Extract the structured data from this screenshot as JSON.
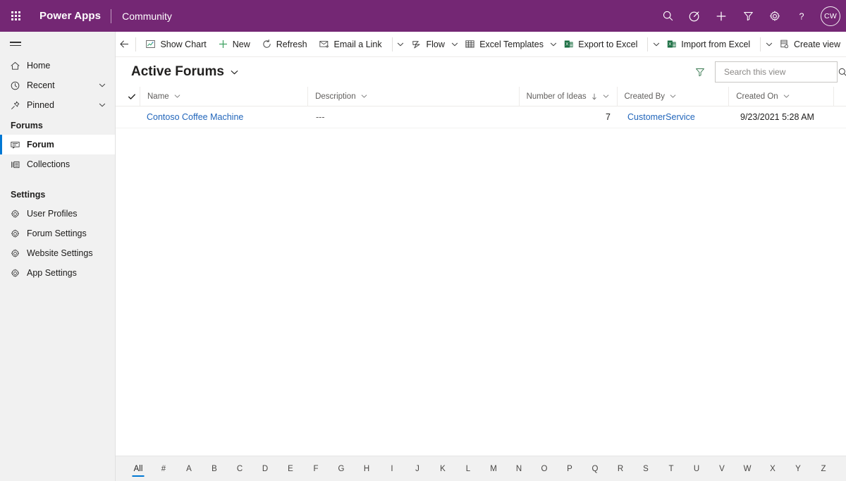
{
  "header": {
    "waffle_label": "app-launcher",
    "brand": "Power Apps",
    "app_name": "Community",
    "avatar_initials": "CW",
    "actions": [
      {
        "name": "search-icon",
        "label": "Search"
      },
      {
        "name": "diagnostics-icon",
        "label": "Diagnostics"
      },
      {
        "name": "add-icon",
        "label": "New"
      },
      {
        "name": "filter-icon",
        "label": "Filter"
      },
      {
        "name": "gear-icon",
        "label": "Settings"
      },
      {
        "name": "help-icon",
        "label": "Help"
      }
    ]
  },
  "sidebar": {
    "top_items": [
      {
        "label": "Home",
        "icon": "home-icon",
        "chevron": false
      },
      {
        "label": "Recent",
        "icon": "clock-icon",
        "chevron": true
      },
      {
        "label": "Pinned",
        "icon": "pin-icon",
        "chevron": true
      }
    ],
    "groups": [
      {
        "title": "Forums",
        "items": [
          {
            "label": "Forum",
            "icon": "forum-icon",
            "selected": true
          },
          {
            "label": "Collections",
            "icon": "collections-icon",
            "selected": false
          }
        ]
      },
      {
        "title": "Settings",
        "items": [
          {
            "label": "User Profiles",
            "icon": "gear-icon",
            "selected": false
          },
          {
            "label": "Forum Settings",
            "icon": "gear-icon",
            "selected": false
          },
          {
            "label": "Website Settings",
            "icon": "gear-icon",
            "selected": false
          },
          {
            "label": "App Settings",
            "icon": "gear-icon",
            "selected": false
          }
        ]
      }
    ]
  },
  "commandbar": {
    "back_label": "Back",
    "show_chart": "Show Chart",
    "new": "New",
    "refresh": "Refresh",
    "email_a_link": "Email a Link",
    "flow": "Flow",
    "excel_templates": "Excel Templates",
    "export_to_excel": "Export to Excel",
    "import_from_excel": "Import from Excel",
    "create_view": "Create view"
  },
  "view": {
    "title": "Active Forums",
    "filter_label": "Edit filters",
    "search_placeholder": "Search this view",
    "search_value": ""
  },
  "grid": {
    "columns": [
      {
        "key": "name",
        "label": "Name",
        "sorted": false
      },
      {
        "key": "description",
        "label": "Description",
        "sorted": false
      },
      {
        "key": "number_of_ideas",
        "label": "Number of Ideas",
        "sorted": true,
        "sort_dir": "desc"
      },
      {
        "key": "created_by",
        "label": "Created By",
        "sorted": false
      },
      {
        "key": "created_on",
        "label": "Created On",
        "sorted": false
      }
    ],
    "rows": [
      {
        "name": "Contoso Coffee Machine",
        "description": "---",
        "number_of_ideas": "7",
        "created_by": "CustomerService",
        "created_on": "9/23/2021 5:28 AM"
      }
    ]
  },
  "alphabar": {
    "selected": "All",
    "items": [
      "All",
      "#",
      "A",
      "B",
      "C",
      "D",
      "E",
      "F",
      "G",
      "H",
      "I",
      "J",
      "K",
      "L",
      "M",
      "N",
      "O",
      "P",
      "Q",
      "R",
      "S",
      "T",
      "U",
      "V",
      "W",
      "X",
      "Y",
      "Z"
    ]
  },
  "colors": {
    "brand_purple": "#742774",
    "accent_blue": "#0078d4",
    "link_blue": "#2266bb",
    "sidebar_bg": "#f1f1f1",
    "excel_green": "#1d7044"
  }
}
